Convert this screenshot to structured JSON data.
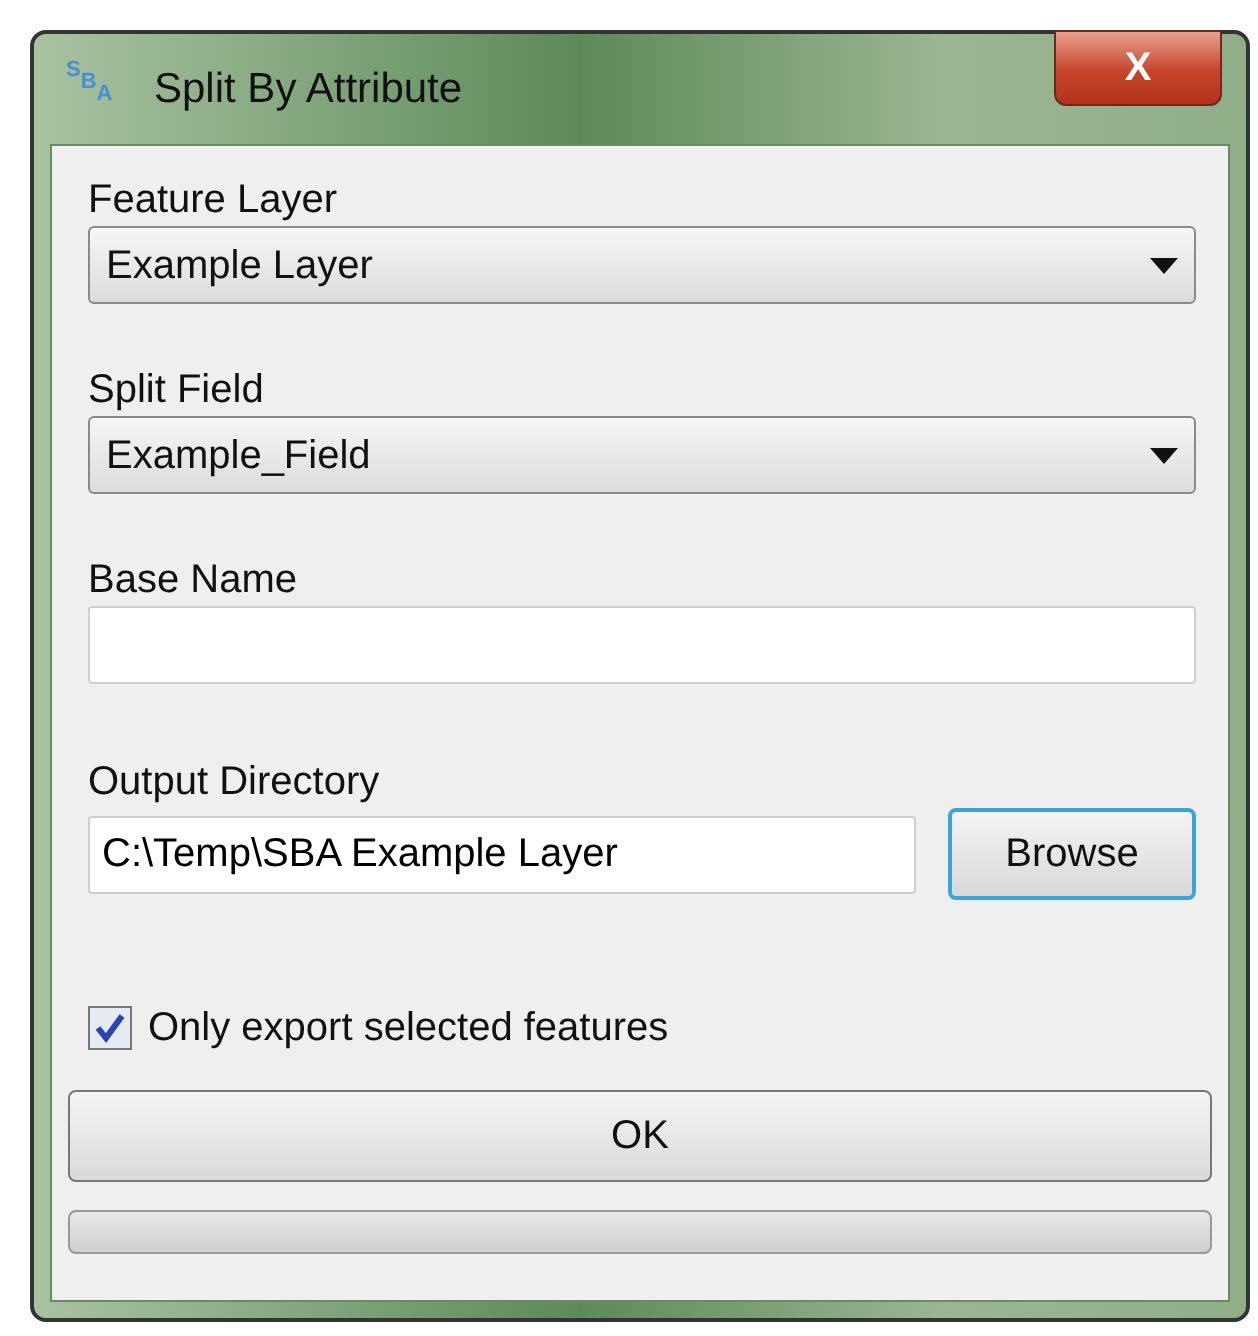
{
  "window": {
    "title": "Split By Attribute",
    "icon_letters": [
      "S",
      "B",
      "A"
    ],
    "close": "X"
  },
  "fields": [
    {
      "kind": "dropdown",
      "label": "Feature Layer",
      "value": "Example Layer"
    },
    {
      "kind": "dropdown",
      "label": "Split Field",
      "value": "Example_Field"
    },
    {
      "kind": "text",
      "label": "Base Name"
    },
    {
      "kind": "browse",
      "label": "Output Directory",
      "value": "C:\\Temp\\SBA Example Layer",
      "button": "Browse"
    }
  ],
  "checkbox": {
    "label": "Only export selected features",
    "checked": true
  },
  "ok_button": "OK",
  "progress": {
    "level": 0
  }
}
